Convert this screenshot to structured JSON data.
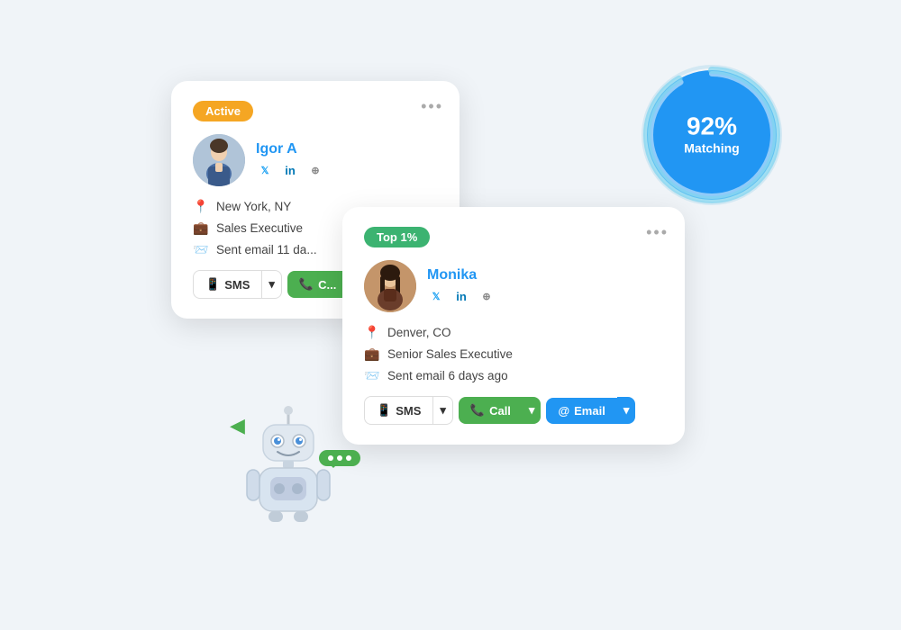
{
  "cards": {
    "igor": {
      "badge": "Active",
      "name": "Igor A",
      "location": "New York, NY",
      "title": "Sales Executive",
      "last_contact": "Sent email 11 da...",
      "sms_label": "SMS",
      "call_label": "C..."
    },
    "monika": {
      "badge": "Top 1%",
      "name": "Monika",
      "location": "Denver, CO",
      "title": "Senior Sales Executive",
      "last_contact": "Sent email 6 days ago",
      "sms_label": "SMS",
      "call_label": "Call",
      "email_label": "Email"
    }
  },
  "matching": {
    "percent": "92%",
    "label": "Matching"
  },
  "social": {
    "twitter": "𝕏",
    "linkedin": "in",
    "globe": "🌐"
  },
  "icons": {
    "location": "📍",
    "briefcase": "💼",
    "email_sent": "📨",
    "phone": "📱",
    "phone_call": "📞",
    "at": "@",
    "more": "•••",
    "chevron": "▾"
  }
}
